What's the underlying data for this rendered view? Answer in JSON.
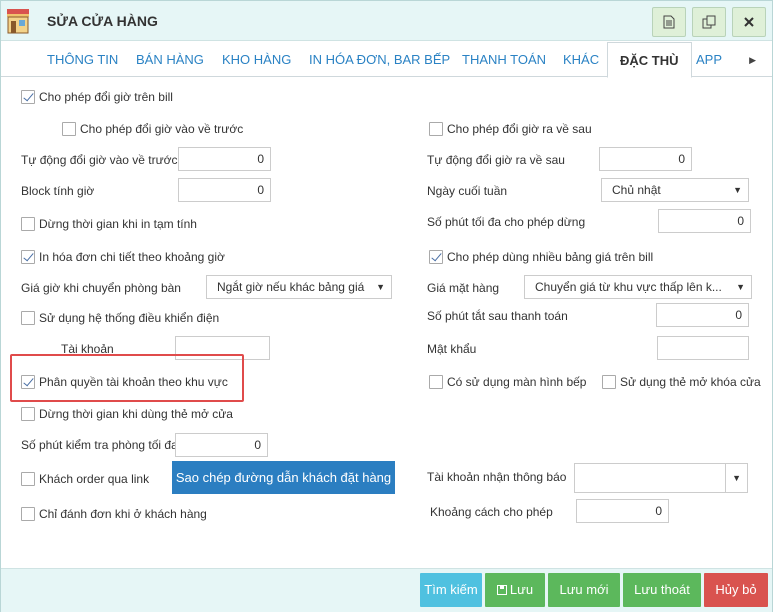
{
  "window": {
    "title": "SỬA CỬA HÀNG"
  },
  "titlebar": {
    "icons": [
      "document-icon",
      "copy-icon",
      "close-icon"
    ]
  },
  "tabs": [
    {
      "label": "THÔNG TIN"
    },
    {
      "label": "BÁN HÀNG"
    },
    {
      "label": "KHO HÀNG"
    },
    {
      "label": "IN HÓA ĐƠN, BAR BẾP"
    },
    {
      "label": "THANH TOÁN"
    },
    {
      "label": "KHÁC"
    },
    {
      "label": "ĐẶC THÙ",
      "active": true
    },
    {
      "label": "APP"
    }
  ],
  "form": {
    "allow_change_time": "Cho phép đổi giờ trên bill",
    "allow_time_in_back": "Cho phép đổi giờ vào về trước",
    "allow_time_out_back": "Cho phép đổi giờ ra về sau",
    "auto_time_in_label": "Tự động đổi giờ vào về trước",
    "auto_time_in_value": "0",
    "auto_time_out_label": "Tự động đổi giờ ra về sau",
    "auto_time_out_value": "0",
    "block_label": "Block tính giờ",
    "block_value": "0",
    "weekend_label": "Ngày cuối tuần",
    "weekend_value": "Chủ nhật",
    "pause_on_print": "Dừng thời gian khi in tạm tính",
    "max_pause_label": "Số phút tối đa cho phép dừng",
    "max_pause_value": "0",
    "print_detail": "In hóa đơn chi tiết theo khoảng giờ",
    "multi_price": "Cho phép dùng nhiều bảng giá trên bill",
    "price_on_move_label": "Giá giờ khi chuyển phòng bàn",
    "price_on_move_value": "Ngắt giờ nếu khác bảng giá",
    "item_price_label": "Giá mặt hàng",
    "item_price_value": "Chuyển giá từ khu vực thấp lên k...",
    "use_power": "Sử dụng hệ thống điều khiển điện",
    "auto_off_label": "Số phút tắt sau thanh toán",
    "auto_off_value": "0",
    "account_label": "Tài khoản",
    "account_value": "",
    "password_label": "Mật khẩu",
    "password_value": "",
    "area_permission": "Phân quyền tài khoản theo khu vực",
    "kitchen_screen": "Có sử dụng màn hình bếp",
    "unlock_card": "Sử dụng thẻ mở khóa cửa",
    "pause_on_card": "Dừng thời gian khi dùng thẻ mở cửa",
    "check_room_label": "Số phút kiểm tra phòng tối đa",
    "check_room_value": "0",
    "customer_order": "Khách order qua link",
    "copy_link_button": "Sao chép đường dẫn khách đặt hàng",
    "notify_account_label": "Tài khoản nhận thông báo",
    "notify_account_value": "",
    "only_at_store": "Chỉ đánh đơn khi ở khách hàng",
    "distance_label": "Khoảng cách cho phép",
    "distance_value": "0"
  },
  "footer": {
    "search": "Tìm kiếm",
    "save": "Lưu",
    "save_new": "Lưu mới",
    "save_exit": "Lưu thoát",
    "cancel": "Hủy bỏ"
  },
  "colors": {
    "accent_blue": "#2b7ec1",
    "tab_blue": "#2a82c4",
    "footer_bg": "#e6f6f6",
    "green": "#5cb85c",
    "cyan": "#4fc1e0",
    "red": "#d9534f",
    "highlight": "#e04b4b"
  }
}
